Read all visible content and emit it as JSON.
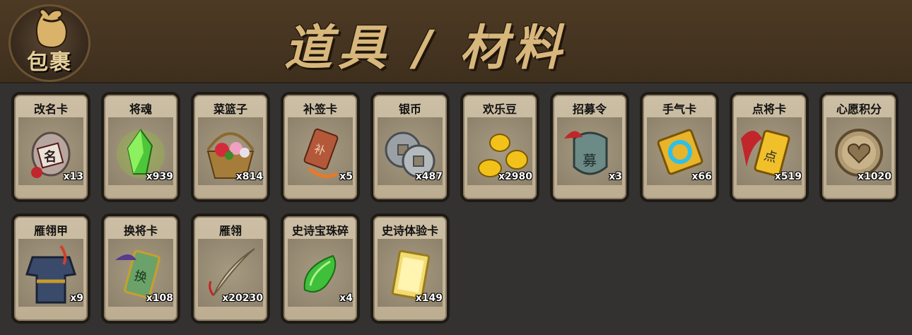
{
  "header": {
    "logo_text": "包裹",
    "title": "道具 / 材料"
  },
  "items": [
    {
      "name": "改名卡",
      "count": "x13",
      "icon": "rename-card-icon"
    },
    {
      "name": "将魂",
      "count": "x939",
      "icon": "green-crystal-icon"
    },
    {
      "name": "菜篮子",
      "count": "x814",
      "icon": "flower-basket-icon"
    },
    {
      "name": "补签卡",
      "count": "x5",
      "icon": "sign-card-icon"
    },
    {
      "name": "银币",
      "count": "x487",
      "icon": "silver-coin-icon"
    },
    {
      "name": "欢乐豆",
      "count": "x2980",
      "icon": "gold-bean-icon"
    },
    {
      "name": "招募令",
      "count": "x3",
      "icon": "recruit-token-icon"
    },
    {
      "name": "手气卡",
      "count": "x66",
      "icon": "luck-card-icon"
    },
    {
      "name": "点将卡",
      "count": "x519",
      "icon": "general-card-icon"
    },
    {
      "name": "心愿积分",
      "count": "x1020",
      "icon": "heart-coin-icon"
    },
    {
      "name": "雁翎甲",
      "count": "x9",
      "icon": "armor-icon"
    },
    {
      "name": "换将卡",
      "count": "x108",
      "icon": "swap-card-icon"
    },
    {
      "name": "雁翎",
      "count": "x20230",
      "icon": "feather-icon"
    },
    {
      "name": "史诗宝珠碎",
      "count": "x4",
      "icon": "green-shard-icon"
    },
    {
      "name": "史诗体验卡",
      "count": "x149",
      "icon": "gold-card-icon"
    }
  ]
}
